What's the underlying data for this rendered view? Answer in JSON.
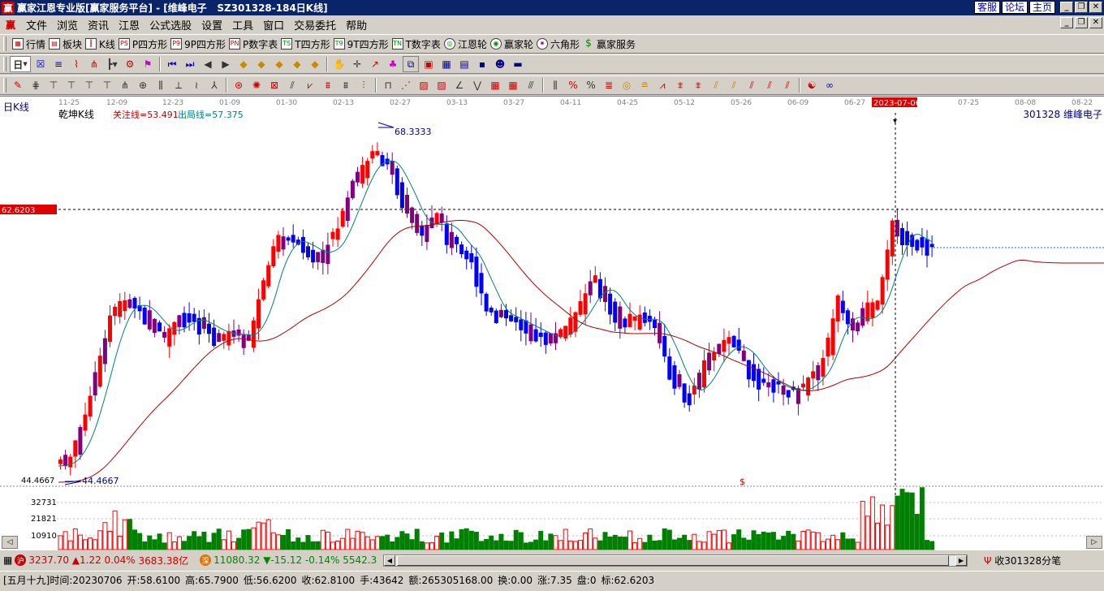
{
  "window": {
    "title": "赢家江恩专业版[赢家服务平台] - [维峰电子   SZ301328-184日K线]",
    "links": [
      "客服",
      "论坛",
      "主页"
    ]
  },
  "menu": [
    "文件",
    "浏览",
    "资讯",
    "江恩",
    "公式选股",
    "设置",
    "工具",
    "窗口",
    "交易委托",
    "帮助"
  ],
  "toolbar1": [
    {
      "label": "行情",
      "icon": "grid-icon"
    },
    {
      "label": "板块",
      "icon": "blocks-icon"
    },
    {
      "label": "K线",
      "icon": "candles-icon"
    },
    {
      "label": "P四方形",
      "icon": "ps-icon"
    },
    {
      "label": "9P四方形",
      "icon": "p9-icon"
    },
    {
      "label": "P数字表",
      "icon": "pn-icon"
    },
    {
      "label": "T四方形",
      "icon": "ts-icon"
    },
    {
      "label": "9T四方形",
      "icon": "t9-icon"
    },
    {
      "label": "T数字表",
      "icon": "tn-icon"
    },
    {
      "label": "江恩轮",
      "icon": "wheel-icon"
    },
    {
      "label": "赢家轮",
      "icon": "winner-wheel-icon"
    },
    {
      "label": "六角形",
      "icon": "hexagon-icon"
    },
    {
      "label": "赢家服务",
      "icon": "dollar-icon"
    }
  ],
  "period": {
    "label": "日"
  },
  "chart": {
    "indicator_name": "日K线",
    "chart_title": "乾坤K线",
    "focus_line": "关注线=53.491",
    "exit_line": "出局线=57.375",
    "stock_label": "301328  维峰电子",
    "price_marker": "62.6203",
    "high_label": "68.3333",
    "low_label": "44.4667",
    "low_axis_label": "44.4667",
    "cursor_date": "2023-07-06",
    "dollar_mark": "$",
    "date_ticks": [
      "11-25",
      "12-09",
      "12-23",
      "01-09",
      "01-30",
      "02-13",
      "02-27",
      "03-13",
      "03-27",
      "04-11",
      "04-25",
      "05-12",
      "05-26",
      "06-09",
      "06-27",
      "07-25",
      "08-08",
      "08-22"
    ],
    "volume_ticks": [
      "32731",
      "21821",
      "10910"
    ]
  },
  "chart_data": {
    "type": "candlestick",
    "title": "乾坤K线",
    "price_range": [
      44.4667,
      68.3333
    ],
    "reference_price": 62.6203,
    "volume_ticks": [
      32731,
      21821,
      10910
    ]
  },
  "status": {
    "sh_badge": "沪",
    "sh_index": "3237.70",
    "sh_change": "▲1.22 0.04%",
    "sh_amount": "3683.38亿",
    "sz_badge": "深",
    "sz_index": "11080.32",
    "sz_change": "▼-15.12 -0.14%",
    "sz_amount": "5542.3",
    "receive": "收301328分笔"
  },
  "info": {
    "lunar": "[五月十九]",
    "time": "时间:20230706",
    "open": "开:58.6100",
    "high": "高:65.7900",
    "low": "低:56.6200",
    "close": "收:62.8100",
    "hand": "手:43642",
    "amount": "额:265305168.00",
    "turnover": "换:0.00",
    "rise": "涨:7.35",
    "pan": "盘:0",
    "mark": "标:62.6203"
  }
}
